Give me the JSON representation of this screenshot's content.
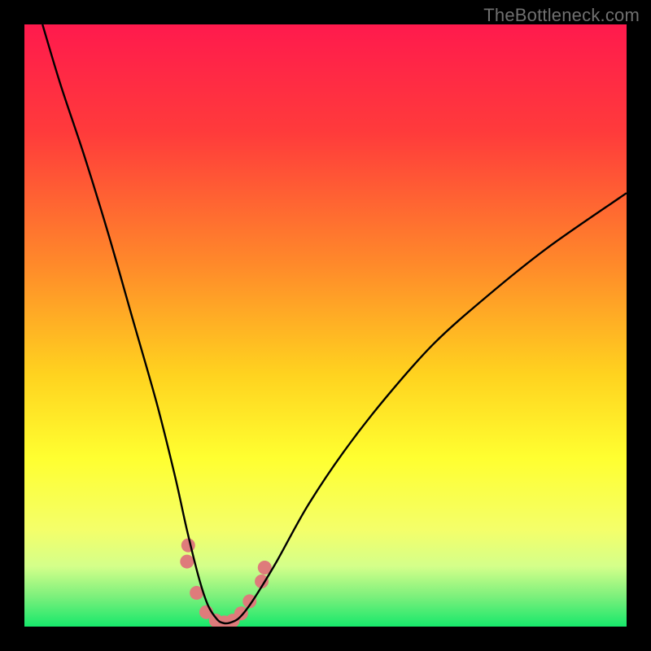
{
  "watermark": "TheBottleneck.com",
  "chart_data": {
    "type": "line",
    "title": "",
    "xlabel": "",
    "ylabel": "",
    "xlim": [
      0,
      100
    ],
    "ylim": [
      0,
      100
    ],
    "valley_x": 33,
    "gradient_stops": [
      {
        "offset": 0,
        "color": "#ff1a4d"
      },
      {
        "offset": 18,
        "color": "#ff3b3b"
      },
      {
        "offset": 40,
        "color": "#ff8a2a"
      },
      {
        "offset": 58,
        "color": "#ffd21f"
      },
      {
        "offset": 72,
        "color": "#ffff30"
      },
      {
        "offset": 84,
        "color": "#f4ff6a"
      },
      {
        "offset": 90,
        "color": "#d4ff8a"
      },
      {
        "offset": 95,
        "color": "#7cf07c"
      },
      {
        "offset": 100,
        "color": "#17e86b"
      }
    ],
    "series": [
      {
        "name": "bottleneck-curve",
        "x": [
          3,
          6,
          10,
          14,
          18,
          22,
          25,
          27,
          29,
          30.5,
          32,
          33,
          34,
          35.5,
          37,
          39,
          42,
          47,
          53,
          60,
          68,
          77,
          87,
          100
        ],
        "y": [
          100,
          90,
          78,
          65,
          51,
          37,
          25,
          16,
          8,
          3.5,
          1.2,
          0.6,
          0.6,
          1.3,
          3.0,
          6,
          11,
          20,
          29,
          38,
          47,
          55,
          63,
          72
        ]
      }
    ],
    "markers": {
      "color": "#de7b7b",
      "pill_points": [
        {
          "x": 27.2,
          "y": 13.5
        },
        {
          "x": 27.0,
          "y": 10.8
        },
        {
          "x": 28.6,
          "y": 5.6
        },
        {
          "x": 30.2,
          "y": 2.4
        },
        {
          "x": 31.8,
          "y": 1.0
        },
        {
          "x": 33.2,
          "y": 0.7
        },
        {
          "x": 34.6,
          "y": 1.0
        },
        {
          "x": 36.0,
          "y": 2.2
        },
        {
          "x": 37.4,
          "y": 4.2
        },
        {
          "x": 39.4,
          "y": 7.5
        },
        {
          "x": 39.9,
          "y": 9.8
        }
      ]
    }
  }
}
